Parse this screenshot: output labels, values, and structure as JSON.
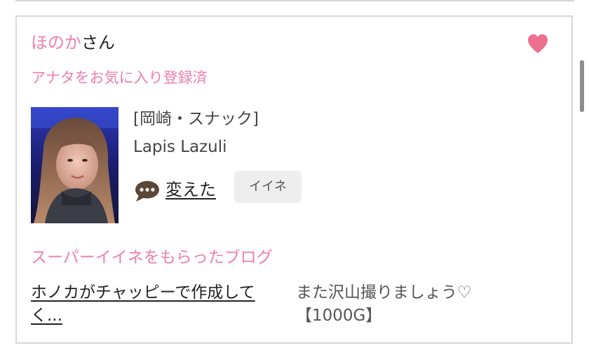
{
  "profile": {
    "name": "ほのか",
    "honorific": "さん",
    "favorite_status": "アナタをお気に入り登録済"
  },
  "shop": {
    "category": "[岡崎・スナック]",
    "name": "Lapis Lazuli"
  },
  "comment": {
    "icon": "speech-bubble-icon",
    "text": "変えた"
  },
  "like_button": {
    "label": "イイネ"
  },
  "super_like": {
    "label": "スーパーイイネをもらったブログ",
    "blog_title": "ホノカがチャッピーで作成してく...",
    "blog_comment": "また沢山撮りましょう♡【1000G】"
  },
  "colors": {
    "accent_pink": "#ee7fb0",
    "heart": "#ef6f8e",
    "comment_icon": "#5a4636"
  }
}
